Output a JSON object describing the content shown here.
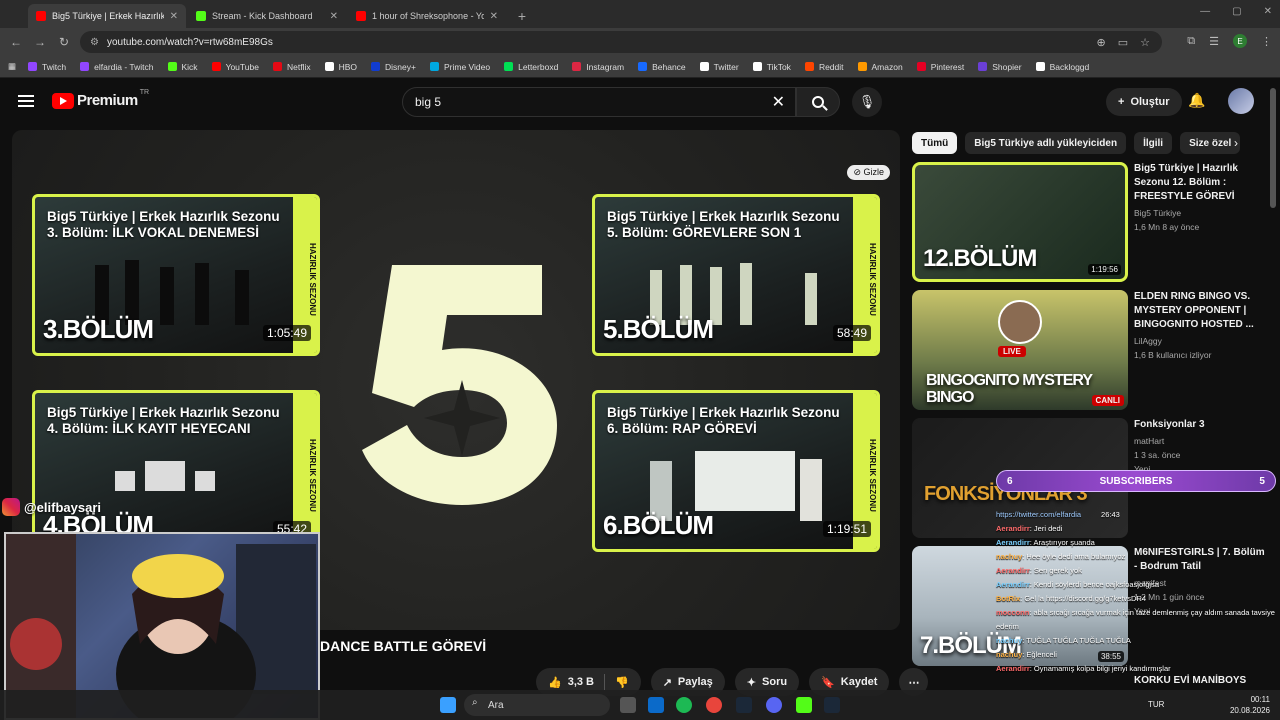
{
  "browser": {
    "tabs": [
      {
        "title": "Big5 Türkiye | Erkek Hazırlık Sezonu",
        "color": "#ff0000",
        "active": true
      },
      {
        "title": "Stream - Kick Dashboard",
        "color": "#53fc18",
        "active": false
      },
      {
        "title": "1 hour of Shreksophone - YouTube",
        "color": "#ff0000",
        "active": false
      }
    ],
    "url": "youtube.com/watch?v=rtw68mE98Gs",
    "profile_letter": "E",
    "bookmarks": [
      {
        "label": "Twitch",
        "color": "#9146ff"
      },
      {
        "label": "elfardia - Twitch",
        "color": "#9146ff"
      },
      {
        "label": "Kick",
        "color": "#53fc18"
      },
      {
        "label": "YouTube",
        "color": "#ff0000"
      },
      {
        "label": "Netflix",
        "color": "#e50914"
      },
      {
        "label": "HBO",
        "color": "#ffffff"
      },
      {
        "label": "Disney+",
        "color": "#113ccf"
      },
      {
        "label": "Prime Video",
        "color": "#00a8e1"
      },
      {
        "label": "Letterboxd",
        "color": "#00e054"
      },
      {
        "label": "Instagram",
        "color": "#dc2743"
      },
      {
        "label": "Behance",
        "color": "#1769ff"
      },
      {
        "label": "Twitter",
        "color": "#ffffff"
      },
      {
        "label": "TikTok",
        "color": "#ffffff"
      },
      {
        "label": "Reddit",
        "color": "#ff4500"
      },
      {
        "label": "Amazon",
        "color": "#ff9900"
      },
      {
        "label": "Pinterest",
        "color": "#e60023"
      },
      {
        "label": "Shopier",
        "color": "#6b3fd6"
      },
      {
        "label": "Backloggd",
        "color": "#ffffff"
      }
    ]
  },
  "youtube": {
    "logo_text": "Premium",
    "logo_cc": "TR",
    "search_value": "big 5",
    "create_label": "Oluştur",
    "hide_label": "Gizle",
    "endcards": [
      {
        "title": "Big5 Türkiye | Erkek Hazırlık Sezonu 3. Bölüm: İLK VOKAL DENEMESİ",
        "episode": "3.BÖLÜM",
        "duration": "1:05:49"
      },
      {
        "title": "Big5 Türkiye | Erkek Hazırlık Sezonu 5. Bölüm: GÖREVLERE SON 1",
        "episode": "5.BÖLÜM",
        "duration": "58:49"
      },
      {
        "title": "Big5 Türkiye | Erkek Hazırlık Sezonu 4. Bölüm: İLK KAYIT HEYECANI",
        "episode": "4.BÖLÜM",
        "duration": "55:42"
      },
      {
        "title": "Big5 Türkiye | Erkek Hazırlık Sezonu 6. Bölüm: RAP GÖREVİ",
        "episode": "6.BÖLÜM",
        "duration": "1:19:51"
      }
    ],
    "endcard_strip": "HAZIRLIK SEZONU",
    "video_title": "DANCE BATTLE GÖREVİ",
    "actions": {
      "like_count": "3,3 B",
      "share": "Paylaş",
      "ask": "Soru",
      "save": "Kaydet"
    },
    "chips": [
      "Tümü",
      "Big5 Türkiye adlı yükleyiciden",
      "İlgili",
      "Size özel"
    ],
    "recommendations": [
      {
        "title": "Big5 Türkiye | Hazırlık Sezonu 12. Bölüm : FREESTYLE GÖREVİ",
        "channel": "Big5 Türkiye",
        "stats": "1,6 Mn  8 ay önce",
        "duration": "1:19:56",
        "thumb_text": "12.BÖLÜM"
      },
      {
        "title": "ELDEN RING BINGO VS. MYSTERY OPPONENT | BINGOGNITO HOSTED ...",
        "channel": "LilAggy",
        "stats": "1,6 B kullanıcı izliyor",
        "badge": "CANLI",
        "live": "LIVE",
        "thumb_text": "BINGOGNITO MYSTERY BINGO"
      },
      {
        "title": "Fonksiyonlar 3",
        "channel": "matHart",
        "stats": "1  3 sa. önce",
        "tag": "Yeni",
        "thumb_text": "FONKSİYONLAR 3"
      },
      {
        "title": "M6NIFESTGIRLS | 7. Bölüm - Bodrum Tatil",
        "channel": "manifest",
        "stats": "1,2 Mn  1 gün önce",
        "tag": "Yeni",
        "duration": "38:55",
        "thumb_text": "7.BÖLÜM"
      },
      {
        "title": "KORKU EVİ MANİBOYS",
        "channel": "",
        "stats": "",
        "thumb_text": ""
      }
    ]
  },
  "overlay": {
    "instagram_handle": "@elifbaysari",
    "subscribers_label": "SUBSCRIBERS",
    "sub_left": "6",
    "sub_right": "5",
    "chat": [
      {
        "user": "",
        "msg": "https://twitter.com/elfardia",
        "time": "26:43"
      },
      {
        "user": "Aerandirr",
        "msg": ": Jeri dedi"
      },
      {
        "user": "Aerandirr",
        "msg": ": Araştırıyor şuanda"
      },
      {
        "user": "nachuy",
        "msg": ": Hee öyle dedi ama bulamıyoz"
      },
      {
        "user": "Aerandirr",
        "msg": ": Sen gerek yok"
      },
      {
        "user": "Aerandirr",
        "msg": ": Kendi söylerdi bence oajksfoasjofğjsa"
      },
      {
        "user": "BotRix",
        "msg": ": Gel la https://discord.gg/g7ketvsDR4"
      },
      {
        "user": "mocconn",
        "msg": ": abla sıcağı sıcağa vurmak için taze demlenmiş çay aldım sanada tavsiye ederim"
      },
      {
        "user": "nachuy",
        "msg": ": TUĞLA TUĞLA TUĞLA TUĞLA"
      },
      {
        "user": "nachuy",
        "msg": ": Eğlenceli"
      },
      {
        "user": "Aerandirr",
        "msg": ": Oynamamış kolpa bilgi jeriyi kandırmışlar"
      }
    ]
  },
  "taskbar": {
    "search_label": "Ara",
    "lang": "TUR",
    "time": "00:11",
    "date": "20.08.2026"
  }
}
